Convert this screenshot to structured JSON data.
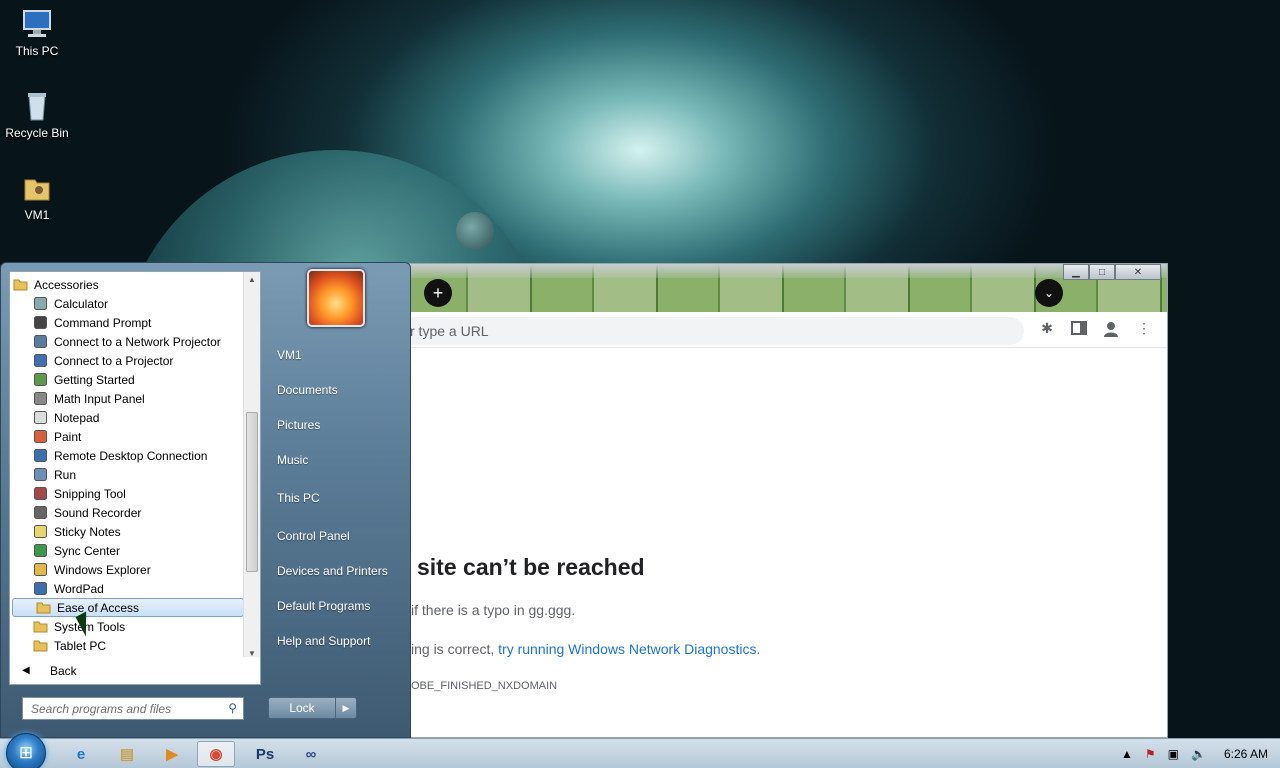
{
  "desktop": {
    "icons": [
      {
        "label": "This PC"
      },
      {
        "label": "Recycle Bin"
      },
      {
        "label": "VM1"
      }
    ]
  },
  "browser": {
    "omnibox_placeholder": "r type a URL",
    "error_title": "site can’t be reached",
    "error_line1": "if there is a typo in gg.ggg.",
    "error_line2_prefix": "ing is correct, ",
    "error_link": "try running Windows Network Diagnostics",
    "error_line2_suffix": ".",
    "error_code": "OBE_FINISHED_NXDOMAIN",
    "window_buttons": {
      "minimize": "▁",
      "maximize": "□",
      "close": "✕"
    }
  },
  "start_menu": {
    "programs": [
      {
        "label": "Accessories",
        "kind": "folder",
        "icon": "folder-icon"
      },
      {
        "label": "Calculator",
        "icon": "calculator-icon"
      },
      {
        "label": "Command Prompt",
        "icon": "cmd-icon"
      },
      {
        "label": "Connect to a Network Projector",
        "icon": "network-projector-icon"
      },
      {
        "label": "Connect to a Projector",
        "icon": "projector-icon"
      },
      {
        "label": "Getting Started",
        "icon": "getting-started-icon"
      },
      {
        "label": "Math Input Panel",
        "icon": "math-input-icon"
      },
      {
        "label": "Notepad",
        "icon": "notepad-icon"
      },
      {
        "label": "Paint",
        "icon": "paint-icon"
      },
      {
        "label": "Remote Desktop Connection",
        "icon": "remote-desktop-icon"
      },
      {
        "label": "Run",
        "icon": "run-icon"
      },
      {
        "label": "Snipping Tool",
        "icon": "scissors-icon"
      },
      {
        "label": "Sound Recorder",
        "icon": "microphone-icon"
      },
      {
        "label": "Sticky Notes",
        "icon": "sticky-note-icon"
      },
      {
        "label": "Sync Center",
        "icon": "sync-icon"
      },
      {
        "label": "Windows Explorer",
        "icon": "explorer-icon"
      },
      {
        "label": "WordPad",
        "icon": "wordpad-icon"
      },
      {
        "label": "Ease of Access",
        "kind": "folder",
        "icon": "folder-icon",
        "selected": true
      },
      {
        "label": "System Tools",
        "kind": "folder",
        "icon": "folder-icon"
      },
      {
        "label": "Tablet PC",
        "kind": "folder",
        "icon": "folder-icon"
      }
    ],
    "back_label": "Back",
    "search_placeholder": "Search programs and files",
    "right_items": [
      {
        "label": "VM1",
        "name": "start-item-vm1"
      },
      {
        "label": "Documents",
        "name": "start-item-documents"
      },
      {
        "label": "Pictures",
        "name": "start-item-pictures"
      },
      {
        "label": "Music",
        "name": "start-item-music"
      },
      {
        "label": "This PC",
        "name": "start-item-this-pc"
      },
      {
        "label": "Control Panel",
        "name": "start-item-control-panel"
      },
      {
        "label": "Devices and Printers",
        "name": "start-item-devices-printers"
      },
      {
        "label": "Default Programs",
        "name": "start-item-default-programs"
      },
      {
        "label": "Help and Support",
        "name": "start-item-help-support"
      }
    ],
    "lock_label": "Lock",
    "lock_arrow": "▶"
  },
  "taskbar": {
    "apps": [
      {
        "name": "ie-icon",
        "glyph": "e",
        "color": "#1e78c8"
      },
      {
        "name": "file-explorer-icon",
        "glyph": "▤",
        "color": "#c9a24a"
      },
      {
        "name": "media-player-icon",
        "glyph": "▶",
        "color": "#e08a1e"
      },
      {
        "name": "chrome-icon",
        "glyph": "◉",
        "color": "#d94a36",
        "active": true
      },
      {
        "name": "photoshop-icon",
        "glyph": "Ps",
        "color": "#1b3a66"
      },
      {
        "name": "glasses-icon",
        "glyph": "∞",
        "color": "#334a8a"
      }
    ],
    "clock": "6:26 AM"
  }
}
